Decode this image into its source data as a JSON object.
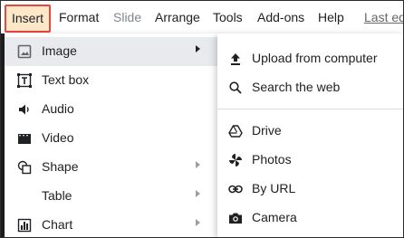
{
  "menubar": {
    "items": [
      {
        "label": "Insert",
        "state": "active"
      },
      {
        "label": "Format",
        "state": "normal"
      },
      {
        "label": "Slide",
        "state": "disabled"
      },
      {
        "label": "Arrange",
        "state": "normal"
      },
      {
        "label": "Tools",
        "state": "normal"
      },
      {
        "label": "Add-ons",
        "state": "normal"
      },
      {
        "label": "Help",
        "state": "normal"
      },
      {
        "label": "Last ed",
        "state": "link"
      }
    ]
  },
  "insert_menu": {
    "items": [
      {
        "label": "Image",
        "icon": "image-icon",
        "submenu": true,
        "highlighted": true
      },
      {
        "label": "Text box",
        "icon": "text-box-icon",
        "submenu": false
      },
      {
        "label": "Audio",
        "icon": "audio-icon",
        "submenu": false
      },
      {
        "label": "Video",
        "icon": "video-icon",
        "submenu": false
      },
      {
        "label": "Shape",
        "icon": "shape-icon",
        "submenu": true
      },
      {
        "label": "Table",
        "icon": "none",
        "submenu": true
      },
      {
        "label": "Chart",
        "icon": "chart-icon",
        "submenu": true
      }
    ]
  },
  "image_submenu": {
    "items": [
      {
        "label": "Upload from computer",
        "icon": "upload-icon"
      },
      {
        "label": "Search the web",
        "icon": "search-icon"
      },
      {
        "label": "Drive",
        "icon": "drive-icon"
      },
      {
        "label": "Photos",
        "icon": "photos-icon"
      },
      {
        "label": "By URL",
        "icon": "link-icon"
      },
      {
        "label": "Camera",
        "icon": "camera-icon"
      }
    ]
  },
  "colors": {
    "active_highlight_bg": "#fde7c9",
    "active_highlight_border": "#e8453c",
    "hover_bg": "#e8eaed",
    "text": "#202124",
    "disabled_text": "#80868b"
  }
}
